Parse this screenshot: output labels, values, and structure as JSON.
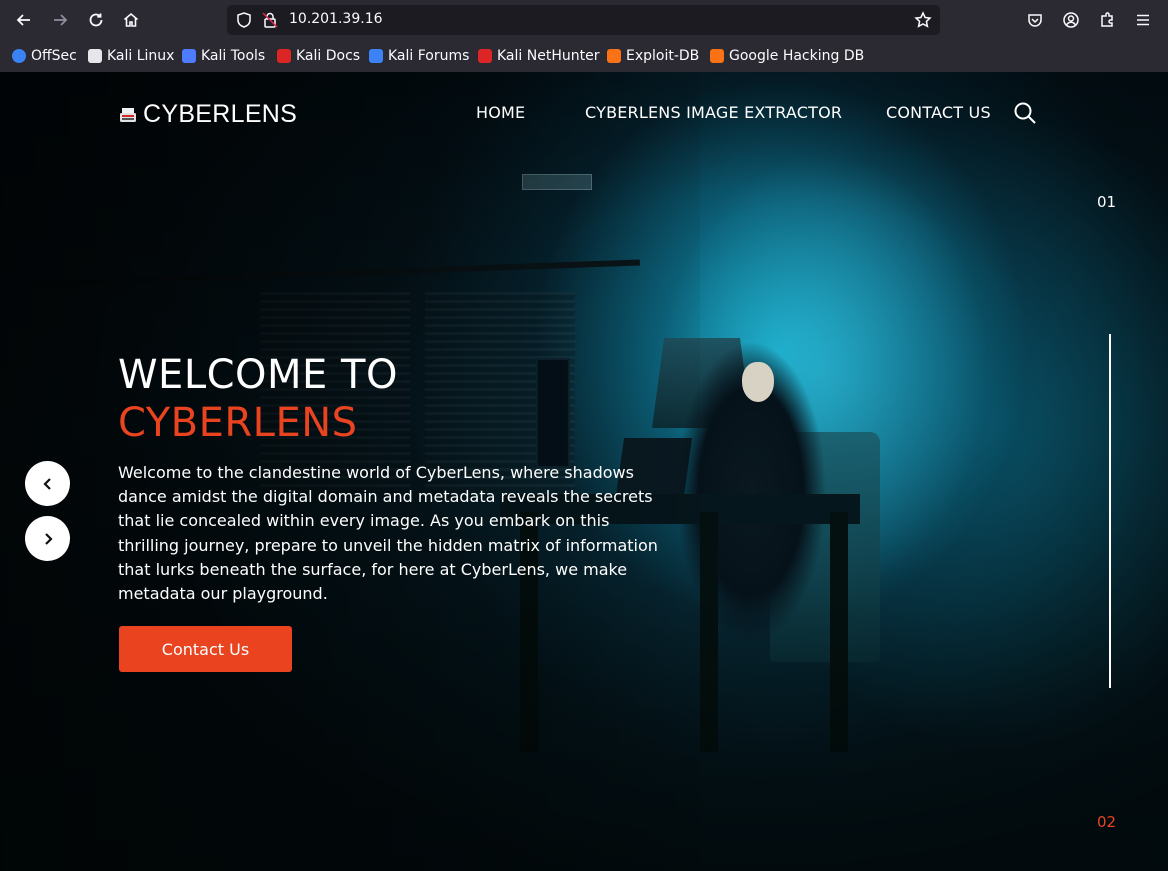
{
  "browser": {
    "url": "10.201.39.16",
    "bookmarks": [
      {
        "label": "OffSec",
        "icon": "offsec-icon",
        "color": "#3b82f6"
      },
      {
        "label": "Kali Linux",
        "icon": "kali-dragon-icon",
        "color": "#e5e7eb"
      },
      {
        "label": "Kali Tools",
        "icon": "kali-tools-icon",
        "color": "#4f7cff"
      },
      {
        "label": "Kali Docs",
        "icon": "kali-docs-icon",
        "color": "#dc2626"
      },
      {
        "label": "Kali Forums",
        "icon": "kali-forums-icon",
        "color": "#3b82f6"
      },
      {
        "label": "Kali NetHunter",
        "icon": "nethunter-icon",
        "color": "#dc2626"
      },
      {
        "label": "Exploit-DB",
        "icon": "exploit-db-icon",
        "color": "#f97316"
      },
      {
        "label": "Google Hacking DB",
        "icon": "ghdb-icon",
        "color": "#f97316"
      }
    ]
  },
  "site": {
    "logo_text": "CYBERLENS",
    "nav": [
      "HOME",
      "CYBERLENS IMAGE EXTRACTOR",
      "CONTACT US"
    ],
    "accent_color": "#e9431f"
  },
  "hero": {
    "title_line1": "WELCOME TO",
    "title_line2": "CYBERLENS",
    "text": "Welcome to the clandestine world of CyberLens, where shadows dance amidst the digital domain and metadata reveals the secrets that lie concealed within every image. As you embark on this thrilling journey, prepare to unveil the hidden matrix of information that lurks beneath the surface, for here at CyberLens, we make metadata our playground.",
    "button_label": "Contact Us"
  },
  "slider": {
    "current": "01",
    "next": "02"
  }
}
